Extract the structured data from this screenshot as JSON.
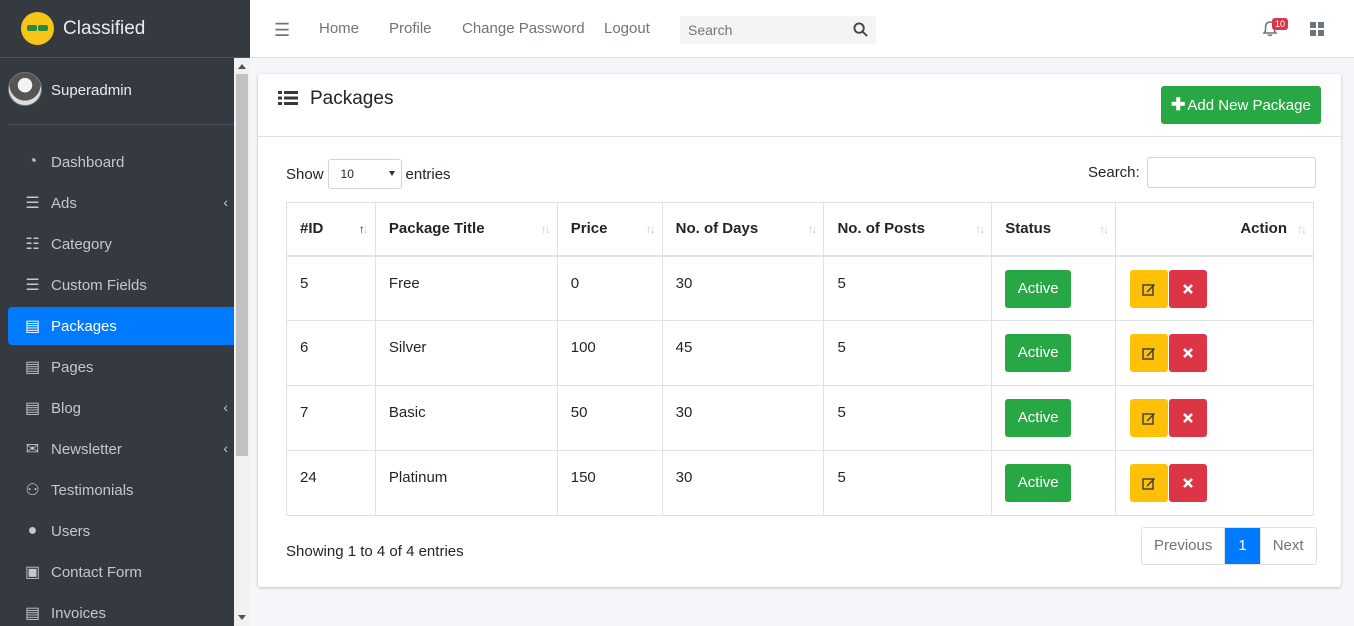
{
  "brand": {
    "title": "Classified"
  },
  "user": {
    "name": "Superadmin"
  },
  "sidebar": {
    "items": [
      {
        "label": "Dashboard",
        "icon": "tachometer-icon",
        "has_submenu": false,
        "active": false
      },
      {
        "label": "Ads",
        "icon": "list-icon",
        "has_submenu": true,
        "active": false
      },
      {
        "label": "Category",
        "icon": "list-alt-icon",
        "has_submenu": false,
        "active": false
      },
      {
        "label": "Custom Fields",
        "icon": "list-icon",
        "has_submenu": false,
        "active": false
      },
      {
        "label": "Packages",
        "icon": "book-icon",
        "has_submenu": false,
        "active": true
      },
      {
        "label": "Pages",
        "icon": "book-icon",
        "has_submenu": false,
        "active": false
      },
      {
        "label": "Blog",
        "icon": "book-icon",
        "has_submenu": true,
        "active": false
      },
      {
        "label": "Newsletter",
        "icon": "envelope-icon",
        "has_submenu": true,
        "active": false
      },
      {
        "label": "Testimonials",
        "icon": "users-icon",
        "has_submenu": false,
        "active": false
      },
      {
        "label": "Users",
        "icon": "user-icon",
        "has_submenu": false,
        "active": false
      },
      {
        "label": "Contact Form",
        "icon": "id-card-icon",
        "has_submenu": false,
        "active": false
      },
      {
        "label": "Invoices",
        "icon": "book-icon",
        "has_submenu": false,
        "active": false
      }
    ]
  },
  "topnav": {
    "links": [
      "Home",
      "Profile",
      "Change Password",
      "Logout"
    ],
    "search_placeholder": "Search",
    "notification_count": "10"
  },
  "card": {
    "title": "Packages",
    "add_button": "Add New Package",
    "show_label": "Show",
    "entries_label": "entries",
    "page_length": "10",
    "search_label": "Search:",
    "columns": [
      "#ID",
      "Package Title",
      "Price",
      "No. of Days",
      "No. of Posts",
      "Status",
      "Action"
    ],
    "rows": [
      {
        "id": "5",
        "title": "Free",
        "price": "0",
        "days": "30",
        "posts": "5",
        "status": "Active"
      },
      {
        "id": "6",
        "title": "Silver",
        "price": "100",
        "days": "45",
        "posts": "5",
        "status": "Active"
      },
      {
        "id": "7",
        "title": "Basic",
        "price": "50",
        "days": "30",
        "posts": "5",
        "status": "Active"
      },
      {
        "id": "24",
        "title": "Platinum",
        "price": "150",
        "days": "30",
        "posts": "5",
        "status": "Active"
      }
    ],
    "info": "Showing 1 to 4 of 4 entries",
    "pagination": {
      "previous": "Previous",
      "current": "1",
      "next": "Next"
    }
  },
  "colors": {
    "sidebar_bg": "#343a40",
    "active": "#007bff",
    "success": "#28a745",
    "warning": "#ffc107",
    "danger": "#dc3545"
  }
}
